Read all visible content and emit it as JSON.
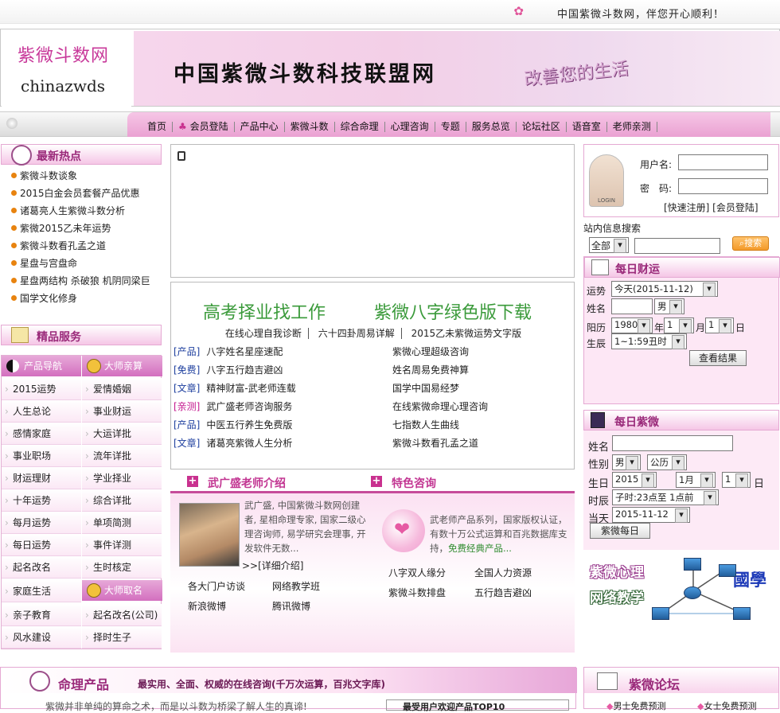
{
  "top": {
    "slogan": "中国紫微斗数网，伴您开心顺利！"
  },
  "banner": {
    "logo_cn": "紫微斗数网",
    "logo_en": "chinazwds",
    "title": "中国紫微斗数科技联盟网",
    "tagline": "改善您的生活"
  },
  "nav": [
    "首页",
    "会员登陆",
    "产品中心",
    "紫微斗数",
    "综合命理",
    "心理咨询",
    "专题",
    "服务总览",
    "论坛社区",
    "语音室",
    "老师亲测"
  ],
  "hot": {
    "title": "最新热点",
    "items": [
      "紫微斗数谈象",
      "2015白金会员套餐产品优惠",
      "诸葛亮人生紫微斗数分析",
      "紫微2015乙未年运势",
      "紫微斗数看孔孟之道",
      "星盘与宫盘命",
      "星盘两结构 杀破狼 机阴同梁巨",
      "国学文化修身"
    ]
  },
  "services": {
    "title": "精品服务",
    "tab1": "产品导航",
    "tab2": "大师亲算",
    "tab3": "大师取名",
    "left": [
      "2015运势",
      "人生总论",
      "感情家庭",
      "事业职场",
      "财运理财",
      "十年运势",
      "每月运势",
      "每日运势",
      "起名改名",
      "家庭生活",
      "亲子教育",
      "风水建设"
    ],
    "right": [
      "爱情婚姻",
      "事业财运",
      "大运详批",
      "流年详批",
      "学业择业",
      "综合详批",
      "单项简测",
      "事件详测",
      "生时核定"
    ],
    "right2": [
      "起名改名(公司)",
      "择时生子"
    ]
  },
  "promo": {
    "left": "高考择业找工作",
    "right": "紫微八字绿色版下载",
    "mini_links": [
      "在线心理自我诊断",
      "六十四卦周易详解",
      "2015乙未紫微运势文字版"
    ]
  },
  "recommend": [
    {
      "tag": "[产品]",
      "title": "八字姓名星座速配",
      "right": "紫微心理超级咨询",
      "red": false
    },
    {
      "tag": "[免费]",
      "title": "八字五行趋吉避凶",
      "right": "姓名周易免费神算",
      "red": false
    },
    {
      "tag": "[文章]",
      "title": "精神财富-武老师连载",
      "right": "国学中国易经梦",
      "red": false
    },
    {
      "tag": "[亲测]",
      "title": "武广盛老师咨询服务",
      "right": "在线紫微命理心理咨询",
      "red": true
    },
    {
      "tag": "[产品]",
      "title": "中医五行养生免费版",
      "right": "七指数人生曲线",
      "red": false
    },
    {
      "tag": "[文章]",
      "title": "诸葛亮紫微人生分析",
      "right": "紫微斗数看孔孟之道",
      "red": false
    }
  ],
  "intro": {
    "teacher_title": "武广盛老师介绍",
    "consult_title": "特色咨询",
    "teacher_text": "武广盛, 中国紫微斗数网创建者, 星相命理专家, 国家二级心理咨询师, 易学研究会理事, 开发软件无数...",
    "teacher_more": ">>[详细介绍]",
    "consult_text": "武老师产品系列，国家版权认证，有数十万公式运算和百兆数据库支持，",
    "consult_green": "免费经典产品...",
    "links_left": [
      "各大门户访谈",
      "网络教学班",
      "新浪微博",
      "腾讯微博"
    ],
    "links_right": [
      "八字双人缘分",
      "全国人力资源",
      "紫微斗数排盘",
      "五行趋吉避凶"
    ]
  },
  "login": {
    "avatar_text": "LOGIN",
    "user_label": "用户名:",
    "pass_label": "密　码:",
    "links": "[快速注册] [会员登陆]"
  },
  "search": {
    "label": "站内信息搜索",
    "scope": "全部",
    "button": "搜索"
  },
  "fortune": {
    "title": "每日财运",
    "yunshi_label": "运势",
    "yunshi_value": "今天(2015-11-12)",
    "name_label": "姓名",
    "gender": "男",
    "yangli_label": "阳历",
    "year": "1980",
    "year_unit": "年",
    "month": "1",
    "month_unit": "月",
    "day": "1",
    "day_unit": "日",
    "shichen_label": "生辰",
    "shichen": "1~1:59丑时",
    "button": "查看结果"
  },
  "ziwei": {
    "title": "每日紫微",
    "name_label": "姓名",
    "gender_label": "性别",
    "gender": "男",
    "calendar": "公历",
    "birth_label": "生日",
    "year": "2015",
    "month": "1月",
    "day": "1",
    "day_unit": "日",
    "shichen_label": "时辰",
    "shichen": "子时:23点至 1点前",
    "date_label": "当天",
    "date": "2015-11-12",
    "button": "紫微每日"
  },
  "ad": {
    "line1": "紫微心理",
    "line2": "网络教学",
    "line3": "國學"
  },
  "bottom": {
    "products_title": "命理产品",
    "products_sub": "最实用、全面、权威的在线咨询(千万次运算，百兆文字库)",
    "products_text": "紫微并非单纯的算命之术，而是以斗数为桥梁了解人生的真谛!",
    "top_box": "最受用户欢迎产品TOP10",
    "forum_title": "紫微论坛",
    "forum_link1": "男士免费预测",
    "forum_link2": "女士免费预测"
  },
  "colors": {
    "accent": "#c9318f",
    "nav_pink": "#f0b3dc",
    "green": "#3a9a3a",
    "blue_tag": "#1d3e9e"
  }
}
